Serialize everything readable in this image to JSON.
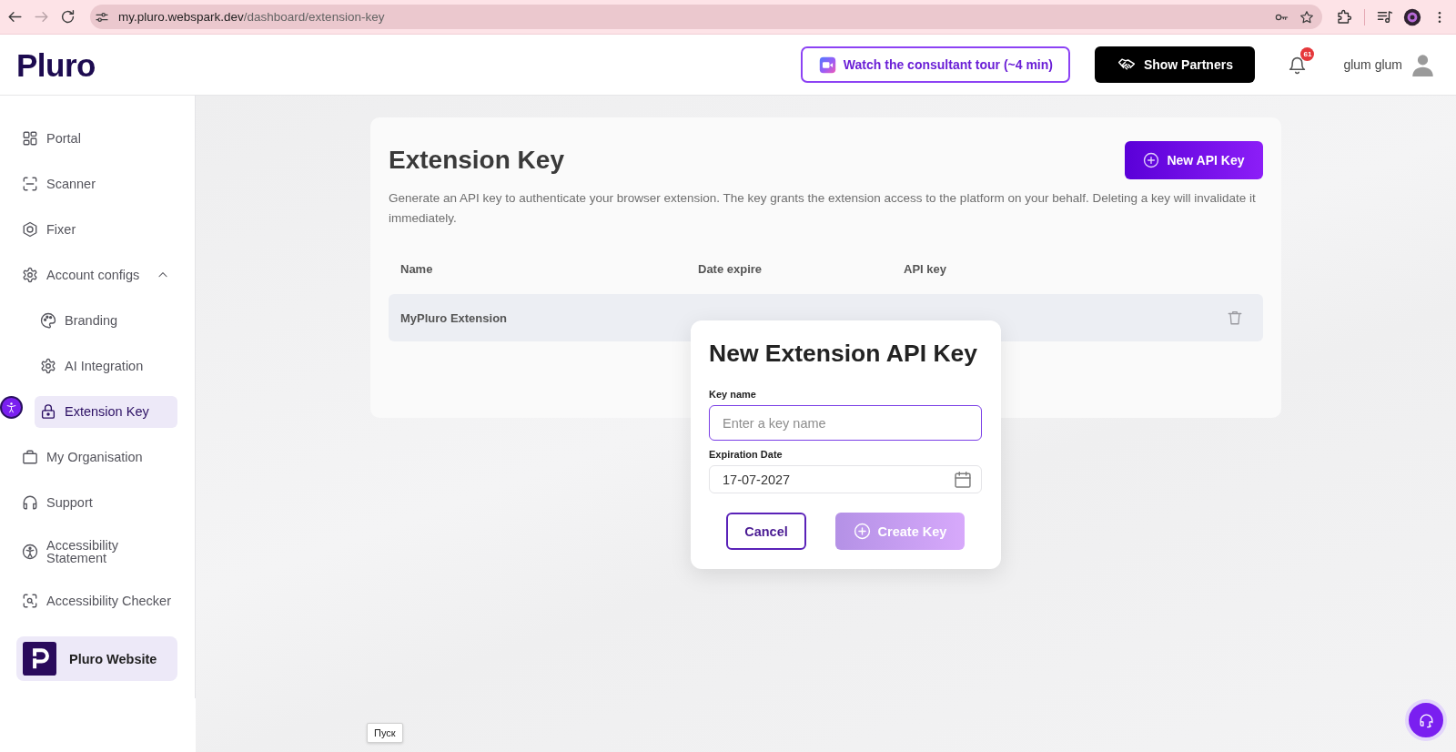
{
  "browser": {
    "nav_buttons": [
      {
        "kind": "back",
        "disabled": false
      },
      {
        "kind": "forward",
        "disabled": true
      },
      {
        "kind": "reload",
        "disabled": false
      }
    ],
    "url": {
      "host": "my.pluro.webspark.dev",
      "path": "/dashboard/extension-key"
    }
  },
  "header": {
    "logo": "Pluro",
    "tour_button": "Watch the consultant tour (~4 min)",
    "partners_button": "Show Partners",
    "notification_count": "61",
    "user_name": "glum glum"
  },
  "sidebar": {
    "items": [
      {
        "label": "Portal",
        "selected": false
      },
      {
        "label": "Scanner",
        "selected": false
      },
      {
        "label": "Fixer",
        "selected": false
      },
      {
        "label": "Account configs",
        "selected": false,
        "expanded": true,
        "children": [
          {
            "label": "Branding",
            "selected": false
          },
          {
            "label": "AI Integration",
            "selected": false
          },
          {
            "label": "Extension Key",
            "selected": true
          }
        ]
      },
      {
        "label": "My Organisation",
        "selected": false
      },
      {
        "label": "Support",
        "selected": false
      },
      {
        "label": "Accessibility Statement",
        "selected": false
      },
      {
        "label": "Accessibility Checker",
        "selected": false
      }
    ],
    "website_link": "Pluro Website"
  },
  "page": {
    "title": "Extension Key",
    "new_key_button": "New API Key",
    "description": "Generate an API key to authenticate your browser extension. The key grants the extension access to the platform on your behalf. Deleting a key will invalidate it immediately.",
    "table": {
      "columns": [
        "Name",
        "Date expire",
        "API key"
      ],
      "rows": [
        {
          "name": "MyPluro Extension"
        }
      ]
    }
  },
  "modal": {
    "title": "New Extension API Key",
    "fields": [
      {
        "kind": "text",
        "label": "Key name",
        "placeholder": "Enter a key name",
        "focused": true
      },
      {
        "kind": "date",
        "label": "Expiration Date",
        "value": "17-07-2027",
        "focused": false
      }
    ],
    "buttons": [
      {
        "kind": "secondary",
        "label": "Cancel",
        "disabled": false
      },
      {
        "kind": "primary",
        "label": "Create Key",
        "disabled": true
      }
    ]
  },
  "tooltip": "Пуск"
}
